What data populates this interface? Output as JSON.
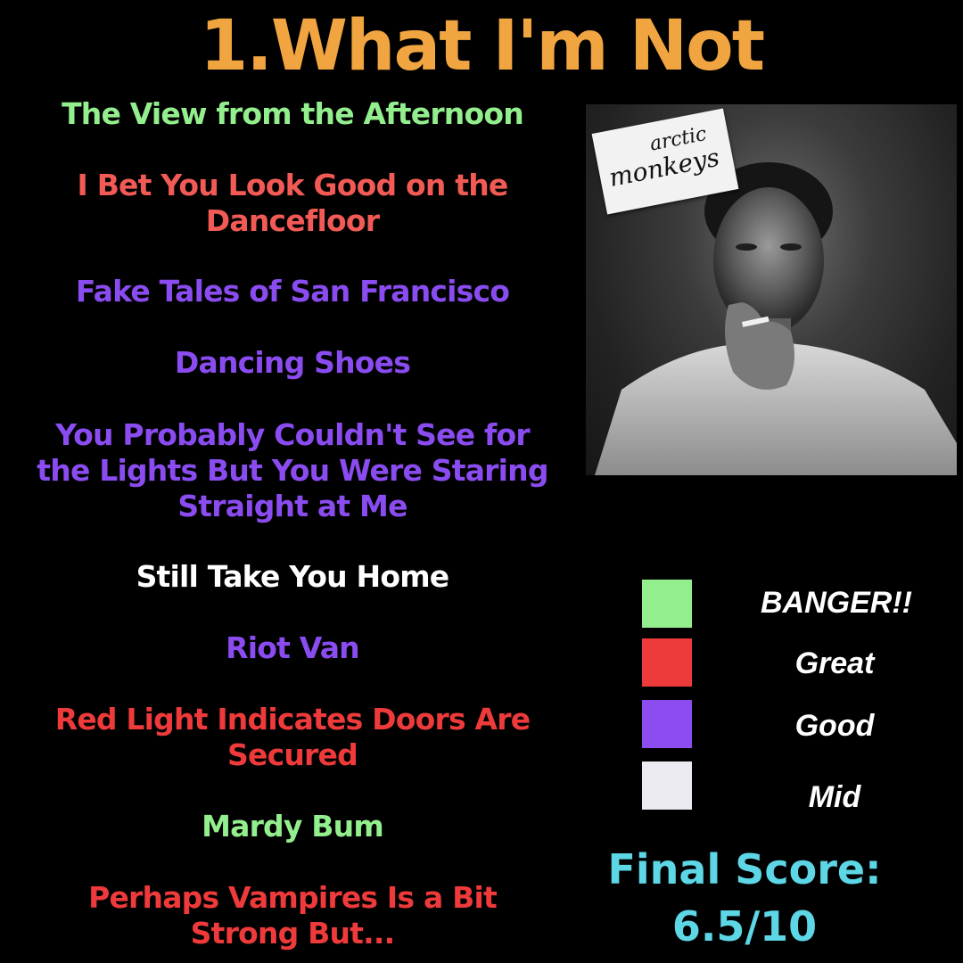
{
  "title": "1.What I'm Not",
  "tracks": [
    {
      "name": "The View from the Afternoon",
      "rating": "BANGER!!"
    },
    {
      "name": "I Bet You Look Good on the Dancefloor",
      "line1": "I Bet You Look Good on the",
      "line2": "Dancefloor",
      "rating": "Great"
    },
    {
      "name": "Fake Tales of San Francisco",
      "rating": "Good"
    },
    {
      "name": "Dancing Shoes",
      "rating": "Good"
    },
    {
      "name": "You Probably Couldn't See for the Lights But You Were Staring Straight at Me",
      "line1": "You Probably Couldn't See for",
      "line2": "the Lights But You Were Staring",
      "line3": "Straight at Me",
      "rating": "Good"
    },
    {
      "name": "Still Take You Home",
      "rating": "Mid"
    },
    {
      "name": "Riot Van",
      "rating": "Good"
    },
    {
      "name": "Red Light Indicates Doors Are Secured",
      "line1": "Red Light Indicates Doors Are",
      "line2": "Secured",
      "rating": "Great"
    },
    {
      "name": "Mardy Bum",
      "rating": "BANGER!!"
    },
    {
      "name": "Perhaps Vampires Is a Bit Strong But...",
      "line1": "Perhaps Vampires Is a Bit",
      "line2": "Strong But...",
      "rating": "Great"
    }
  ],
  "cover": {
    "band_word1": "arctic",
    "band_word2": "monkeys"
  },
  "legend": [
    {
      "label": "BANGER!!",
      "color": "#93ee8e"
    },
    {
      "label": "Great",
      "color": "#ee3a3a"
    },
    {
      "label": "Good",
      "color": "#8c4cf0"
    },
    {
      "label": "Mid",
      "color": "#eaeaf0"
    }
  ],
  "colors": {
    "title": "#f0a541",
    "banger_text": "#93ee8e",
    "great_text_light": "#f25a55",
    "great_text": "#ee3a3a",
    "good_text": "#8a4cf0",
    "mid_text": "#ffffff",
    "score": "#5dd6e6",
    "background": "#000000"
  },
  "score": {
    "label": "Final Score:",
    "value": "6.5/10"
  }
}
